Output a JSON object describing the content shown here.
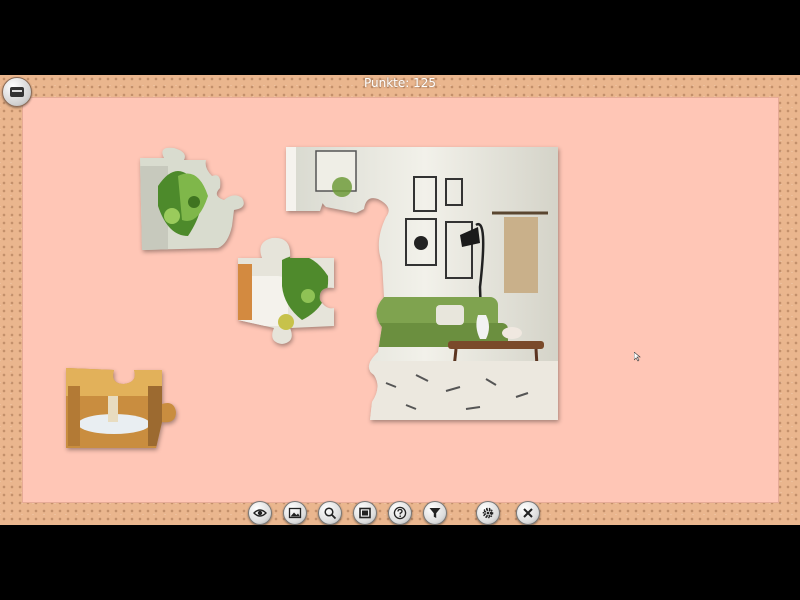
{
  "hud": {
    "score_text": "Punkte: 125"
  },
  "menu_button": {
    "icon": "tray-menu-icon"
  },
  "toolbar": {
    "buttons": [
      {
        "name": "preview",
        "icon": "eye-icon"
      },
      {
        "name": "background",
        "icon": "image-icon"
      },
      {
        "name": "zoom",
        "icon": "magnifier-icon"
      },
      {
        "name": "frame",
        "icon": "square-frame-icon"
      },
      {
        "name": "help",
        "icon": "question-icon"
      },
      {
        "name": "filter",
        "icon": "funnel-icon"
      },
      {
        "name": "settings",
        "icon": "gear-icon"
      },
      {
        "name": "close",
        "icon": "close-icon"
      }
    ]
  },
  "colors": {
    "board": "#ffc6b6",
    "frame": "#eab68e",
    "outside": "#000000"
  }
}
